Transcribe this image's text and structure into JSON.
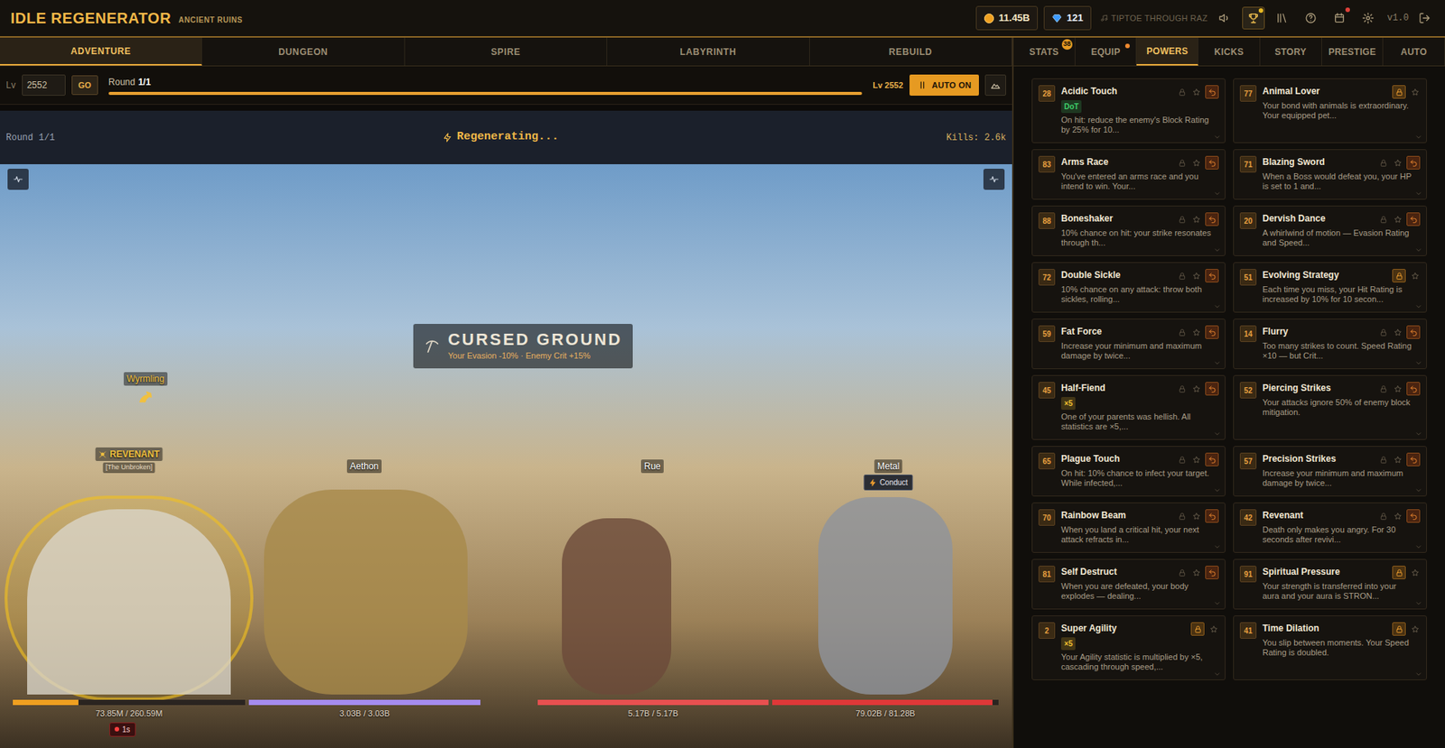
{
  "header": {
    "title": "IDLE REGENERATOR",
    "zone": "ANCIENT RUINS",
    "gold": "11.45B",
    "gems": "121",
    "ticker": "TIPTOE THROUGH RAZ",
    "version": "v1.0",
    "toolbar": [
      {
        "selected": false,
        "alert": false
      },
      {
        "selected": true,
        "alert": true,
        "color": "#e8b923"
      },
      {
        "selected": false,
        "alert": false
      },
      {
        "selected": false,
        "alert": false
      },
      {
        "selected": false,
        "alert": true,
        "color": "#e0413a"
      },
      {
        "selected": false,
        "alert": false
      }
    ]
  },
  "main_tabs": [
    {
      "label": "ADVENTURE",
      "selected": true
    },
    {
      "label": "DUNGEON",
      "selected": false
    },
    {
      "label": "SPIRE",
      "selected": false
    },
    {
      "label": "LABYRINTH",
      "selected": false
    },
    {
      "label": "REBUILD",
      "selected": false
    }
  ],
  "panel_tabs": [
    {
      "label": "STATS",
      "selected": false,
      "badge": "38",
      "dot": false
    },
    {
      "label": "EQUIP",
      "selected": false,
      "dot": true
    },
    {
      "label": "POWERS",
      "selected": true,
      "dot": false
    },
    {
      "label": "KICKS",
      "selected": false,
      "dot": false
    },
    {
      "label": "STORY",
      "selected": false,
      "dot": false
    },
    {
      "label": "PRESTIGE",
      "selected": false,
      "dot": false
    },
    {
      "label": "AUTO",
      "selected": false,
      "dot": false
    }
  ],
  "controls": {
    "level_label": "Lv",
    "level_value": "2552",
    "go": "GO",
    "round_label": "Round",
    "round": "1/1",
    "progress": 1.0,
    "right_level": "Lv 2552",
    "auto": "AUTO ON",
    "auto_on": true
  },
  "battle": {
    "round": "Round 1/1",
    "status": "Regenerating...",
    "kills": "Kills: 2.6k",
    "modifier": {
      "title": "CURSED GROUND",
      "detail": "Your Evasion -10% · Enemy Crit +15%"
    },
    "pet": "Wyrmling",
    "units": [
      {
        "name": "REVENANT",
        "subtitle": "[The Unbroken]",
        "hp": "73.85M / 260.59M",
        "level": 0.283,
        "color": "#f0a020",
        "timer": "1s",
        "selected": true
      },
      {
        "name": "Aethon",
        "hp": "3.03B / 3.03B",
        "level": 1.0,
        "color": "#a58cf0",
        "selected": false
      },
      {
        "name": "Rue",
        "hp": "5.17B / 5.17B",
        "level": 1.0,
        "color": "#e85050",
        "selected": false
      },
      {
        "name": "Metal",
        "hp": "79.02B / 81.28B",
        "level": 0.972,
        "color": "#e03838",
        "tag": "Conduct",
        "selected": false
      }
    ]
  },
  "powers": [
    {
      "number": "28",
      "title": "Acidic Touch",
      "tag": "DoT",
      "tag_color": "#3fcf6a",
      "description": "On hit: reduce the enemy's Block Rating by 25% for 10...",
      "locked": false
    },
    {
      "number": "77",
      "title": "Animal Lover",
      "description": "Your bond with animals is extraordinary. Your equipped pet...",
      "locked": true
    },
    {
      "number": "83",
      "title": "Arms Race",
      "description": "You've entered an arms race and you intend to win. Your...",
      "locked": false
    },
    {
      "number": "71",
      "title": "Blazing Sword",
      "description": "When a Boss would defeat you, your HP is set to 1 and...",
      "locked": false
    },
    {
      "number": "88",
      "title": "Boneshaker",
      "description": "10% chance on hit: your strike resonates through th...",
      "locked": false
    },
    {
      "number": "20",
      "title": "Dervish Dance",
      "description": "A whirlwind of motion — Evasion Rating and Speed...",
      "locked": false
    },
    {
      "number": "72",
      "title": "Double Sickle",
      "description": "10% chance on any attack: throw both sickles, rolling...",
      "locked": false
    },
    {
      "number": "51",
      "title": "Evolving Strategy",
      "description": "Each time you miss, your Hit Rating is increased by 10% for 10 secon...",
      "locked": true
    },
    {
      "number": "59",
      "title": "Fat Force",
      "description": "Increase your minimum and maximum damage by twice...",
      "locked": false
    },
    {
      "number": "14",
      "title": "Flurry",
      "description": "Too many strikes to count. Speed Rating ×10 — but Crit...",
      "locked": false
    },
    {
      "number": "45",
      "title": "Half-Fiend",
      "tag": "×5",
      "tag_color": "#f0c030",
      "description": "One of your parents was hellish. All statistics are ×5,...",
      "locked": false
    },
    {
      "number": "52",
      "title": "Piercing Strikes",
      "description": "Your attacks ignore 50% of enemy block mitigation.",
      "locked": false
    },
    {
      "number": "65",
      "title": "Plague Touch",
      "description": "On hit: 10% chance to infect your target. While infected,...",
      "locked": false
    },
    {
      "number": "57",
      "title": "Precision Strikes",
      "description": "Increase your minimum and maximum damage by twice...",
      "locked": false
    },
    {
      "number": "70",
      "title": "Rainbow Beam",
      "description": "When you land a critical hit, your next attack refracts in...",
      "locked": false
    },
    {
      "number": "42",
      "title": "Revenant",
      "description": "Death only makes you angry. For 30 seconds after revivi...",
      "locked": false
    },
    {
      "number": "81",
      "title": "Self Destruct",
      "description": "When you are defeated, your body explodes — dealing...",
      "locked": false
    },
    {
      "number": "91",
      "title": "Spiritual Pressure",
      "description": "Your strength is transferred into your aura and your aura is STRON...",
      "locked": true
    },
    {
      "number": "2",
      "title": "Super Agility",
      "tag": "×5",
      "tag_color": "#f0c030",
      "description": "Your Agility statistic is multiplied by ×5, cascading through speed,...",
      "locked": true
    },
    {
      "number": "41",
      "title": "Time Dilation",
      "description": "You slip between moments. Your Speed Rating is doubled.",
      "locked": true
    }
  ]
}
